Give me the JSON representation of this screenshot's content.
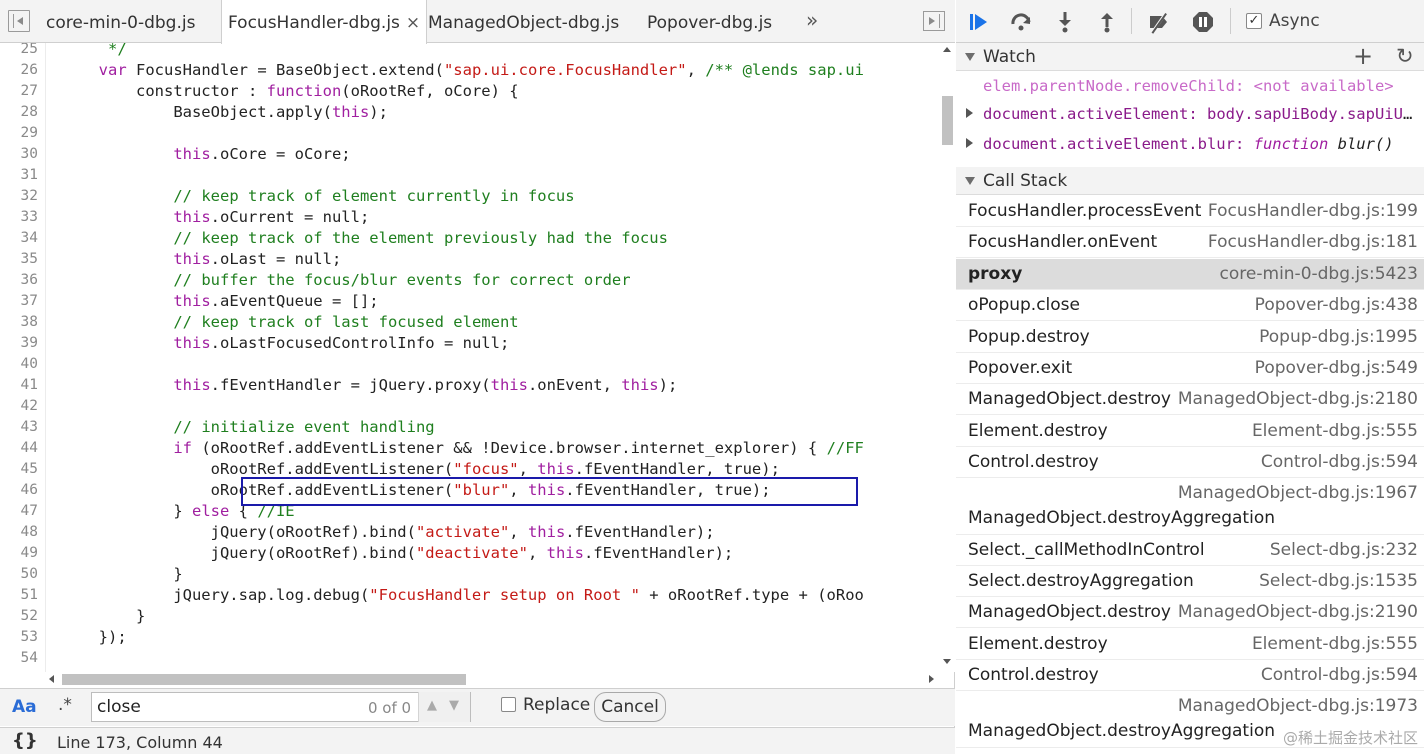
{
  "editor": {
    "tabs": [
      {
        "label": "core-min-0-dbg.js"
      },
      {
        "label": "FocusHandler-dbg.js",
        "active": true,
        "close": "×"
      },
      {
        "label": "ManagedObject-dbg.js"
      },
      {
        "label": "Popover-dbg.js"
      }
    ],
    "more_tabs": "»",
    "lines": [
      {
        "n": "25",
        "t": "         */"
      },
      {
        "n": "26",
        "t": "        var FocusHandler = BaseObject.extend(\"sap.ui.core.FocusHandler\", /** @lends sap.ui"
      },
      {
        "n": "27",
        "t": "            constructor : function(oRootRef, oCore) {"
      },
      {
        "n": "28",
        "t": "                BaseObject.apply(this);"
      },
      {
        "n": "29",
        "t": ""
      },
      {
        "n": "30",
        "t": "                this.oCore = oCore;"
      },
      {
        "n": "31",
        "t": ""
      },
      {
        "n": "32",
        "t": "                // keep track of element currently in focus"
      },
      {
        "n": "33",
        "t": "                this.oCurrent = null;"
      },
      {
        "n": "34",
        "t": "                // keep track of the element previously had the focus"
      },
      {
        "n": "35",
        "t": "                this.oLast = null;"
      },
      {
        "n": "36",
        "t": "                // buffer the focus/blur events for correct order"
      },
      {
        "n": "37",
        "t": "                this.aEventQueue = [];"
      },
      {
        "n": "38",
        "t": "                // keep track of last focused element"
      },
      {
        "n": "39",
        "t": "                this.oLastFocusedControlInfo = null;"
      },
      {
        "n": "40",
        "t": ""
      },
      {
        "n": "41",
        "t": "                this.fEventHandler = jQuery.proxy(this.onEvent, this);"
      },
      {
        "n": "42",
        "t": ""
      },
      {
        "n": "43",
        "t": "                // initialize event handling"
      },
      {
        "n": "44",
        "t": "                if (oRootRef.addEventListener && !Device.browser.internet_explorer) { //FF"
      },
      {
        "n": "45",
        "t": "                    oRootRef.addEventListener(\"focus\", this.fEventHandler, true);"
      },
      {
        "n": "46",
        "t": "                    oRootRef.addEventListener(\"blur\", this.fEventHandler, true);"
      },
      {
        "n": "47",
        "t": "                } else { //IE"
      },
      {
        "n": "48",
        "t": "                    jQuery(oRootRef).bind(\"activate\", this.fEventHandler);"
      },
      {
        "n": "49",
        "t": "                    jQuery(oRootRef).bind(\"deactivate\", this.fEventHandler);"
      },
      {
        "n": "50",
        "t": "                }"
      },
      {
        "n": "51",
        "t": "                jQuery.sap.log.debug(\"FocusHandler setup on Root \" + oRootRef.type + (oRoo"
      },
      {
        "n": "52",
        "t": "            }"
      },
      {
        "n": "53",
        "t": "        });"
      },
      {
        "n": "54",
        "t": ""
      },
      {
        "n": "55",
        "t": ""
      }
    ],
    "search": {
      "case_label": "Aa",
      "regex_label": ".*",
      "value": "close",
      "count": "0 of 0",
      "replace_label": "Replace",
      "cancel_label": "Cancel"
    },
    "status": {
      "braces": "{}",
      "position": "Line 173, Column 44"
    }
  },
  "debugger": {
    "async_label": "Async",
    "async_checked": true,
    "watch": {
      "title": "Watch",
      "plus": "+",
      "refresh": "↻",
      "items": [
        {
          "key": "elem.parentNode.removeChild",
          "value": "<not available>",
          "kind": "na"
        },
        {
          "key": "document.activeElement",
          "value": "body.sapUiBody.sapUiUfdShellBody",
          "kind": "obj"
        },
        {
          "key": "document.activeElement.blur",
          "value_kw": "function",
          "value": "blur()",
          "kind": "fn"
        }
      ]
    },
    "callstack": {
      "title": "Call Stack",
      "frames": [
        {
          "fn": "FocusHandler.processEvent",
          "loc": "FocusHandler-dbg.js:199"
        },
        {
          "fn": "FocusHandler.onEvent",
          "loc": "FocusHandler-dbg.js:181"
        },
        {
          "fn": "proxy",
          "loc": "core-min-0-dbg.js:5423",
          "selected": true
        },
        {
          "fn": "oPopup.close",
          "loc": "Popover-dbg.js:438"
        },
        {
          "fn": "Popup.destroy",
          "loc": "Popup-dbg.js:1995"
        },
        {
          "fn": "Popover.exit",
          "loc": "Popover-dbg.js:549"
        },
        {
          "fn": "ManagedObject.destroy",
          "loc": "ManagedObject-dbg.js:2180"
        },
        {
          "fn": "Element.destroy",
          "loc": "Element-dbg.js:555"
        },
        {
          "fn": "Control.destroy",
          "loc": "Control-dbg.js:594"
        },
        {
          "fn": "ManagedObject.destroyAggregation",
          "loc": "ManagedObject-dbg.js:1967",
          "tall": true
        },
        {
          "fn": "Select._callMethodInControl",
          "loc": "Select-dbg.js:232"
        },
        {
          "fn": "Select.destroyAggregation",
          "loc": "Select-dbg.js:1535"
        },
        {
          "fn": "ManagedObject.destroy",
          "loc": "ManagedObject-dbg.js:2190"
        },
        {
          "fn": "Element.destroy",
          "loc": "Element-dbg.js:555"
        },
        {
          "fn": "Control.destroy",
          "loc": "Control-dbg.js:594"
        },
        {
          "fn": "ManagedObject.destroyAggregation",
          "loc": "ManagedObject-dbg.js:1973",
          "tall": true
        }
      ]
    },
    "watermark": "@稀土掘金技术社区"
  }
}
